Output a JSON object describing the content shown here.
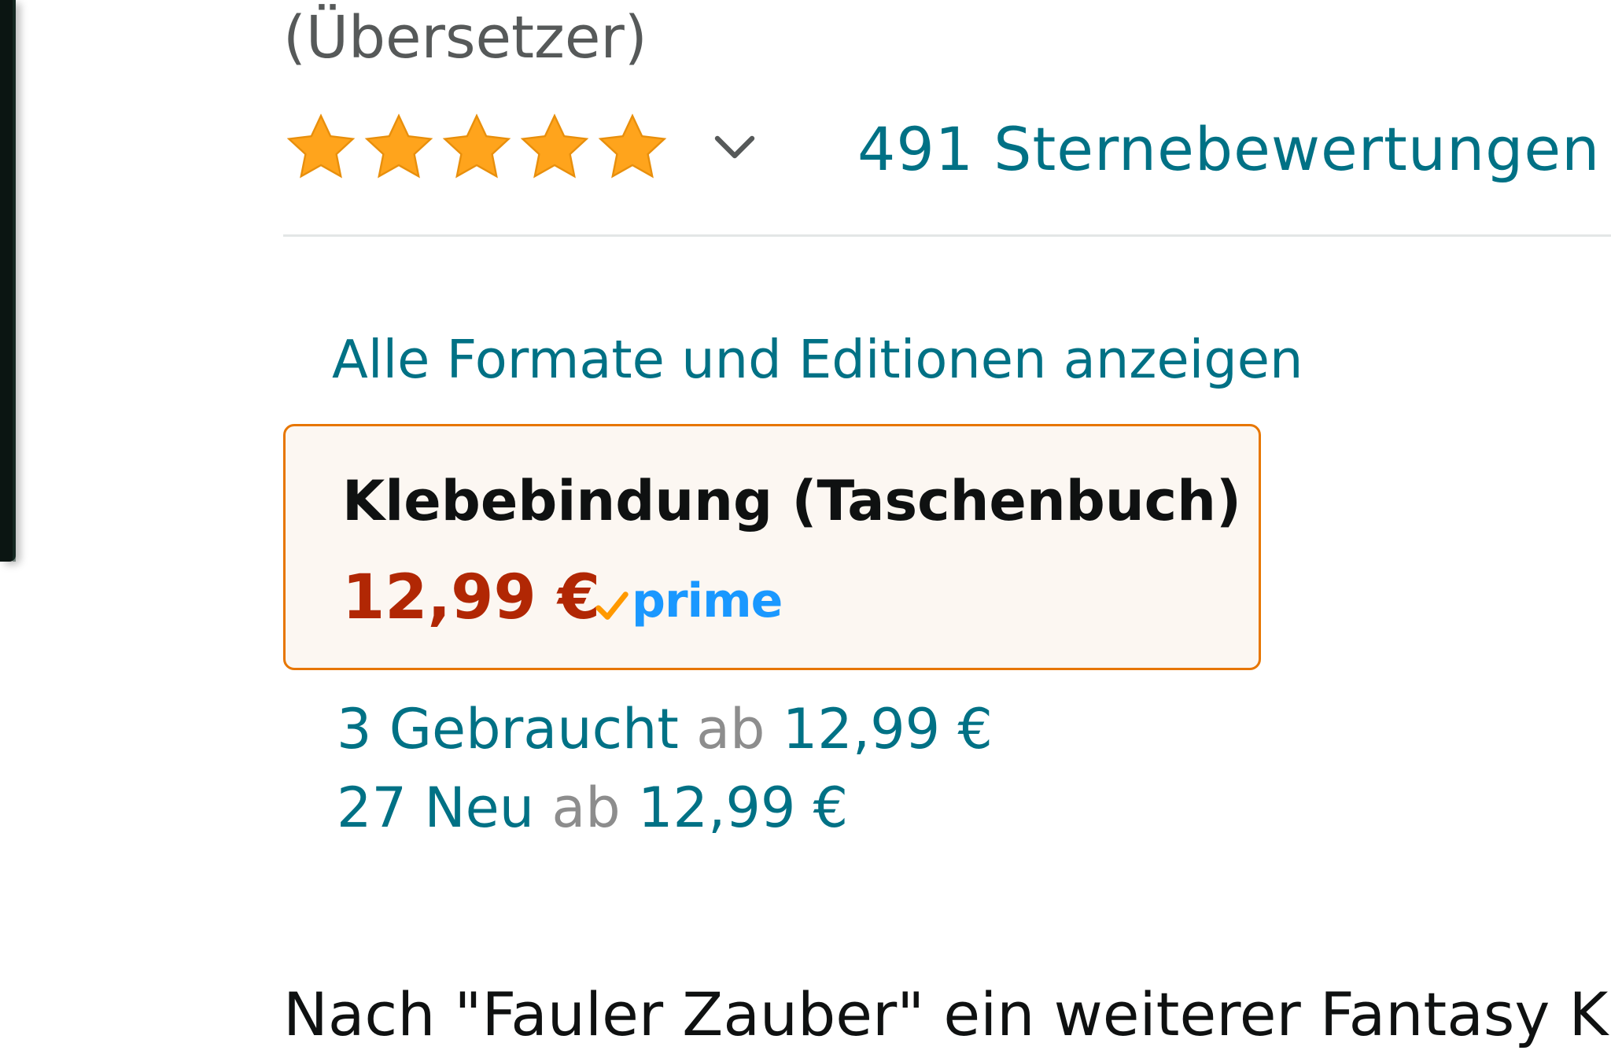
{
  "product": {
    "contributor_role": "(Übersetzer)",
    "rating": {
      "stars_filled": 5,
      "stars_total": 5,
      "count_text": "491 Sternebewertungen"
    },
    "formats_link": "Alle Formate und Editionen anzeigen",
    "selected_format": {
      "name": "Klebebindung (Taschenbuch)",
      "price": "12,99 €",
      "prime_label": "prime"
    },
    "offers": {
      "used": {
        "label": "3 Gebraucht",
        "from": "ab",
        "price": "12,99 €"
      },
      "new": {
        "label": "27 Neu",
        "from": "ab",
        "price": "12,99 €"
      }
    },
    "description_start": "Nach \"Fauler Zauber\" ein weiterer Fantasy Kl"
  },
  "colors": {
    "link": "#007185",
    "price": "#b12704",
    "star": "#ffa41c",
    "format_border": "#e77600",
    "format_bg": "#fcf7f2",
    "prime": "#1a98ff"
  },
  "icons": {
    "star": "star-icon",
    "chevron": "chevron-down-icon",
    "prime_check": "prime-check-icon"
  }
}
